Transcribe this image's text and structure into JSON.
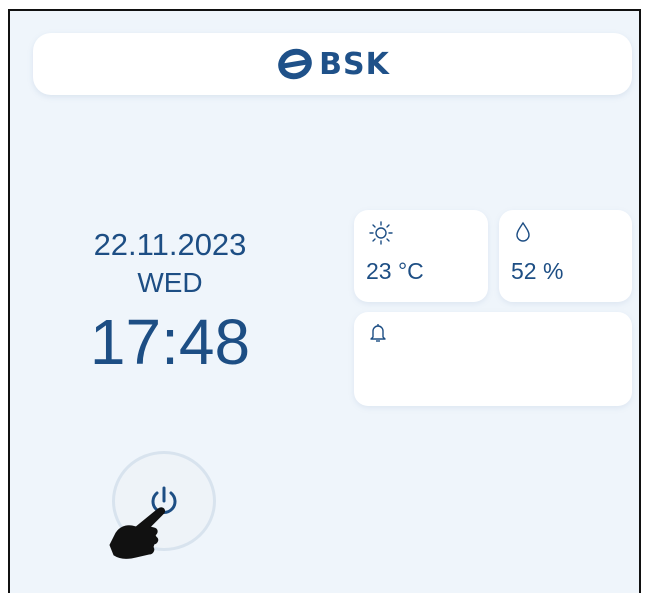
{
  "header": {
    "brand": "BSK",
    "brand_color": "#1f5189"
  },
  "clock": {
    "date": "22.11.2023",
    "day": "WED",
    "time": "17:48"
  },
  "tiles": {
    "temperature": {
      "icon": "sun-icon",
      "value": "23 °C"
    },
    "humidity": {
      "icon": "water-drop-icon",
      "value": "52 %"
    },
    "notifications": {
      "icon": "bell-icon"
    }
  },
  "controls": {
    "power": {
      "icon": "power-icon"
    }
  },
  "overlay": {
    "cursor": "pointing-hand-icon"
  },
  "colors": {
    "background": "#eff5fb",
    "card": "#ffffff",
    "text": "#1d4e84"
  }
}
